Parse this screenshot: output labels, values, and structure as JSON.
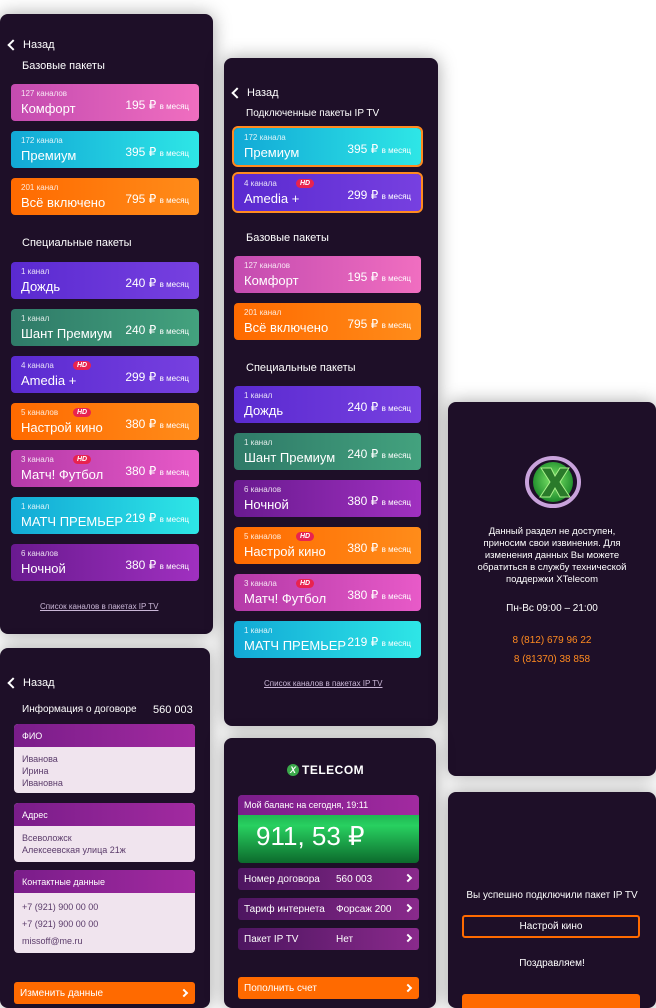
{
  "screen1": {
    "back": "Назад",
    "section_base": "Базовые пакеты",
    "section_special": "Специальные пакеты",
    "link": "Список каналов в пакетах IP TV",
    "base": [
      {
        "count": "127 каналов",
        "name": "Комфорт",
        "price": "195 ₽",
        "per": "в месяц"
      },
      {
        "count": "172 канала",
        "name": "Премиум",
        "price": "395 ₽",
        "per": "в месяц"
      },
      {
        "count": "201 канал",
        "name": "Всё включено",
        "price": "795 ₽",
        "per": "в месяц"
      }
    ],
    "special": [
      {
        "count": "1 канал",
        "name": "Дождь",
        "price": "240 ₽",
        "per": "в месяц"
      },
      {
        "count": "1 канал",
        "name": "Шант Премиум",
        "price": "240 ₽",
        "per": "в месяц"
      },
      {
        "count": "4 канала",
        "name": "Amedia +",
        "price": "299 ₽",
        "per": "в месяц",
        "hd": "HD"
      },
      {
        "count": "5 каналов",
        "name": "Настрой кино",
        "price": "380 ₽",
        "per": "в месяц",
        "hd": "HD"
      },
      {
        "count": "3 канала",
        "name": "Матч! Футбол",
        "price": "380 ₽",
        "per": "в месяц",
        "hd": "HD"
      },
      {
        "count": "1 канал",
        "name": "МАТЧ ПРЕМЬЕР",
        "price": "219 ₽",
        "per": "в месяц"
      },
      {
        "count": "6 каналов",
        "name": "Ночной",
        "price": "380 ₽",
        "per": "в месяц"
      }
    ]
  },
  "screen2": {
    "back": "Назад",
    "section_connected": "Подключенные пакеты IP TV",
    "section_base": "Базовые пакеты",
    "section_special": "Специальные пакеты",
    "link": "Список каналов в пакетах IP TV",
    "connected": [
      {
        "count": "172 канала",
        "name": "Премиум",
        "price": "395 ₽",
        "per": "в месяц"
      },
      {
        "count": "4 канала",
        "name": "Amedia +",
        "price": "299 ₽",
        "per": "в месяц",
        "hd": "HD"
      }
    ],
    "base": [
      {
        "count": "127 каналов",
        "name": "Комфорт",
        "price": "195 ₽",
        "per": "в месяц"
      },
      {
        "count": "201 канал",
        "name": "Всё включено",
        "price": "795 ₽",
        "per": "в месяц"
      }
    ],
    "special": [
      {
        "count": "1 канал",
        "name": "Дождь",
        "price": "240 ₽",
        "per": "в месяц"
      },
      {
        "count": "1 канал",
        "name": "Шант Премиум",
        "price": "240 ₽",
        "per": "в месяц"
      },
      {
        "count": "6 каналов",
        "name": "Ночной",
        "price": "380 ₽",
        "per": "в месяц"
      },
      {
        "count": "5 каналов",
        "name": "Настрой кино",
        "price": "380 ₽",
        "per": "в месяц",
        "hd": "HD"
      },
      {
        "count": "3 канала",
        "name": "Матч! Футбол",
        "price": "380 ₽",
        "per": "в месяц",
        "hd": "HD"
      },
      {
        "count": "1 канал",
        "name": "МАТЧ ПРЕМЬЕР",
        "price": "219 ₽",
        "per": "в месяц"
      }
    ]
  },
  "screen3": {
    "message": "Данный раздел не доступен, приносим свои извинения. Для изменения данных Вы можете обратиться в службу технической поддержки XTelecom",
    "hours": "Пн-Вс  09:00 – 21:00",
    "phone1": "8 (812) 679 96 22",
    "phone2": "8 (81370) 38 858"
  },
  "screen4": {
    "back": "Назад",
    "contract_label": "Информация о договоре",
    "contract_no": "560 003",
    "fio_title": "ФИО",
    "fio": [
      "Иванова",
      "Ирина",
      "Ивановна"
    ],
    "addr_title": "Адрес",
    "addr": [
      "Всеволожск",
      "Алексеевская улица 21ж"
    ],
    "contacts_title": "Контактные данные",
    "contacts": [
      "+7 (921) 900 00 00",
      "+7 (921) 900 00 00",
      "missoff@me.ru"
    ],
    "change_btn": "Изменить данные"
  },
  "screen5": {
    "brand": "TELECOM",
    "balance_label": "Мой баланс на сегодня, 19:11",
    "balance": "911, 53 ₽",
    "rows": [
      {
        "label": "Номер договора",
        "value": "560 003"
      },
      {
        "label": "Тариф интернета",
        "value": "Форсаж 200"
      },
      {
        "label": "Пакет IP TV",
        "value": "Нет"
      }
    ],
    "topup": "Пополнить счет"
  },
  "screen6": {
    "success": "Вы успешно подключили пакет IP TV",
    "package": "Настрой кино",
    "congrats": "Поздравляем!"
  },
  "colors": {
    "bg": "#1e0f28",
    "accent": "#ff8a20",
    "pink": "#e85ac8",
    "green": "#2ac26a"
  }
}
